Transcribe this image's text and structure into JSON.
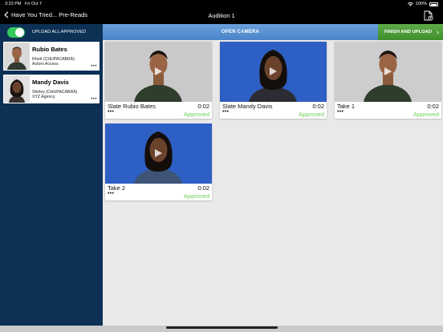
{
  "status_bar": {
    "time": "3:23 PM",
    "date": "Fri Oct 7",
    "battery": "100%"
  },
  "nav": {
    "back_label": "Have You Tried... Pre-Reads",
    "title": "Audition 1",
    "doc_icon": "document-upload-icon"
  },
  "sidebar": {
    "upload_toggle_label": "UPLOAD ALL APPROVED",
    "upload_toggle_on": true,
    "actors": [
      {
        "name": "Rubio Bates",
        "role": "Rhett (CHUPACABRA)",
        "agency": "Actors Access",
        "more": "•••"
      },
      {
        "name": "Mandy Davis",
        "role": "Shirley (CHUPACABRA)",
        "agency": "XYZ Agency",
        "more": "•••"
      }
    ]
  },
  "toolbar": {
    "open_camera": "OPEN CAMERA",
    "finish_upload": "FINISH AND UPLOAD",
    "finish_chevron": "›"
  },
  "clips": [
    {
      "label": "Slate Rubio Bates",
      "duration": "0:02",
      "status": "Approved",
      "more": "•••"
    },
    {
      "label": "Slate Mandy Davis",
      "duration": "0:02",
      "status": "Approved",
      "more": "•••"
    },
    {
      "label": "Take 1",
      "duration": "0:02",
      "status": "Approved",
      "more": "•••"
    },
    {
      "label": "Take 2",
      "duration": "0:02",
      "status": "Approved",
      "more": "•••"
    }
  ],
  "colors": {
    "sidebar_bg": "#0c3155",
    "open_camera_bg": "#5a93d3",
    "finish_bg": "#4f9e3b",
    "approved": "#6fcf5a",
    "toggle_on": "#34c759",
    "blue_backdrop": "#2e5fc4",
    "grey_backdrop": "#c8c8c8"
  }
}
